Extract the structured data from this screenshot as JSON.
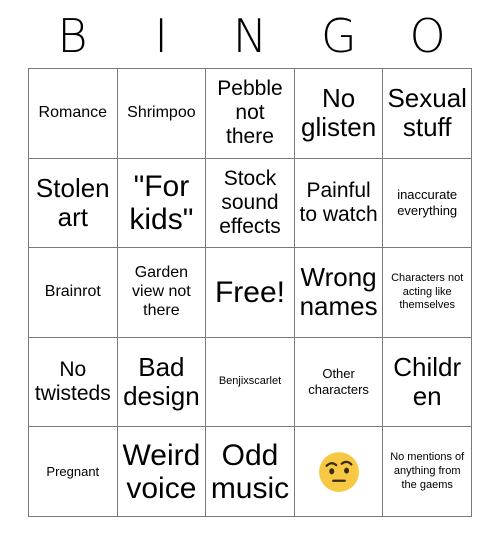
{
  "card": {
    "title": "BINGO",
    "header_letters": [
      "B",
      "I",
      "N",
      "G",
      "O"
    ],
    "grid_size": "5x5",
    "colors": {
      "background": "#ffffff",
      "text": "#000000",
      "border": "#7a7a7a",
      "emoji_face": "#f7c843"
    },
    "cells": [
      {
        "text": "Romance",
        "size": "m",
        "type": "text"
      },
      {
        "text": "Shrimpoo",
        "size": "m",
        "type": "text"
      },
      {
        "text": "Pebble not there",
        "size": "l",
        "type": "text"
      },
      {
        "text": "No glisten",
        "size": "xl",
        "type": "text"
      },
      {
        "text": "Sexual stuff",
        "size": "xl",
        "type": "text"
      },
      {
        "text": "Stolen art",
        "size": "xl",
        "type": "text"
      },
      {
        "text": "\"For kids\"",
        "size": "xxl",
        "type": "text"
      },
      {
        "text": "Stock sound effects",
        "size": "l",
        "type": "text"
      },
      {
        "text": "Painful to watch",
        "size": "l",
        "type": "text"
      },
      {
        "text": "inaccurate everything",
        "size": "s",
        "type": "text"
      },
      {
        "text": "Brainrot",
        "size": "m",
        "type": "text"
      },
      {
        "text": "Garden view not there",
        "size": "m",
        "type": "text"
      },
      {
        "text": "Free!",
        "size": "xxl",
        "type": "free"
      },
      {
        "text": "Wrong names",
        "size": "xl",
        "type": "text"
      },
      {
        "text": "Characters not acting like themselves",
        "size": "xs",
        "type": "text"
      },
      {
        "text": "No twisteds",
        "size": "l",
        "type": "text"
      },
      {
        "text": "Bad design",
        "size": "xl",
        "type": "text"
      },
      {
        "text": "Benjixscarlet",
        "size": "xs",
        "type": "text"
      },
      {
        "text": "Other characters",
        "size": "s",
        "type": "text"
      },
      {
        "text": "Children",
        "size": "xl",
        "type": "text"
      },
      {
        "text": "Pregnant",
        "size": "s",
        "type": "text"
      },
      {
        "text": "Weird voice",
        "size": "xxl",
        "type": "text"
      },
      {
        "text": "Odd music",
        "size": "xxl",
        "type": "text"
      },
      {
        "text": "",
        "size": "m",
        "type": "emoji",
        "emoji": "raised-eyebrow-face",
        "emoji_char": "🤨"
      },
      {
        "text": "No mentions of anything from the gaems",
        "size": "xs",
        "type": "text"
      }
    ]
  }
}
